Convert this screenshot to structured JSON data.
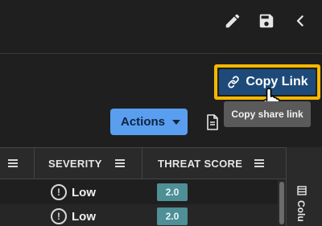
{
  "toolbar": {
    "edit_icon": "pencil-icon",
    "save_icon": "save-icon",
    "back_icon": "chevron-left-icon"
  },
  "copy_link": {
    "label": "Copy Link",
    "icon": "link-icon",
    "tooltip": "Copy share link"
  },
  "actions": {
    "label": "Actions",
    "icon": "caret-down-icon",
    "doc_icon": "document-icon"
  },
  "table": {
    "columns": [
      {
        "label": "SEVERITY"
      },
      {
        "label": "THREAT SCORE"
      }
    ],
    "rows": [
      {
        "severity": "Low",
        "score": "2.0"
      },
      {
        "severity": "Low",
        "score": "2.0"
      }
    ]
  },
  "side_panel": {
    "label": "Colu"
  },
  "colors": {
    "highlight": "#f5b800",
    "primary_button": "#1d4a79",
    "actions_button": "#5a9ef0",
    "score_badge": "#4f8f96"
  }
}
